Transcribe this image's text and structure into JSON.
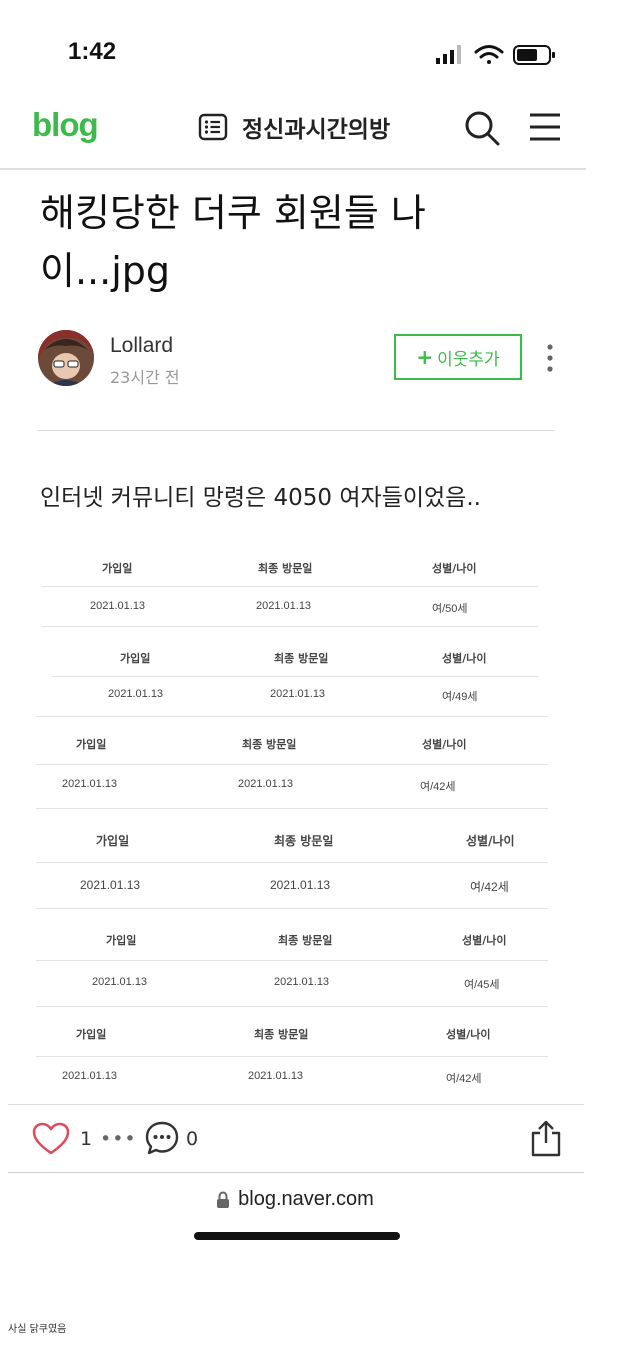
{
  "status_bar": {
    "time": "1:42"
  },
  "header": {
    "logo": "blog",
    "blog_name": "정신과시간의방"
  },
  "post": {
    "title_line1": "해킹당한 더쿠 회원들 나",
    "title_line2": "이...jpg",
    "author": "Lollard",
    "time": "23시간 전",
    "add_neighbor_plus": "+",
    "add_neighbor": "이웃추가",
    "body_text": "인터넷 커뮤니티 망령은 4050 여자들이었음.."
  },
  "table_blocks": [
    {
      "headers": [
        "가입일",
        "최종 방문일",
        "성별/나이"
      ],
      "values": [
        "2021.01.13",
        "2021.01.13",
        "여/50세"
      ]
    },
    {
      "headers": [
        "가입일",
        "최종 방문일",
        "성별/나이"
      ],
      "values": [
        "2021.01.13",
        "2021.01.13",
        "여/49세"
      ]
    },
    {
      "headers": [
        "가입일",
        "최종 방문일",
        "성별/나이"
      ],
      "values": [
        "2021.01.13",
        "2021.01.13",
        "여/42세"
      ]
    },
    {
      "headers": [
        "가입일",
        "최종 방문일",
        "성별/나이"
      ],
      "values": [
        "2021.01.13",
        "2021.01.13",
        "여/42세"
      ]
    },
    {
      "headers": [
        "가입일",
        "최종 방문일",
        "성별/나이"
      ],
      "values": [
        "2021.01.13",
        "2021.01.13",
        "여/45세"
      ]
    },
    {
      "headers": [
        "가입일",
        "최종 방문일",
        "성별/나이"
      ],
      "values": [
        "2021.01.13",
        "2021.01.13",
        "여/42세"
      ]
    }
  ],
  "actions": {
    "like_count": "1",
    "like_more": "•••",
    "comment_count": "0"
  },
  "url_bar": {
    "url": "blog.naver.com"
  },
  "caption": "사실 닭쿠였음",
  "colors": {
    "accent": "#3dbb4a",
    "like": "#e04a5a"
  }
}
